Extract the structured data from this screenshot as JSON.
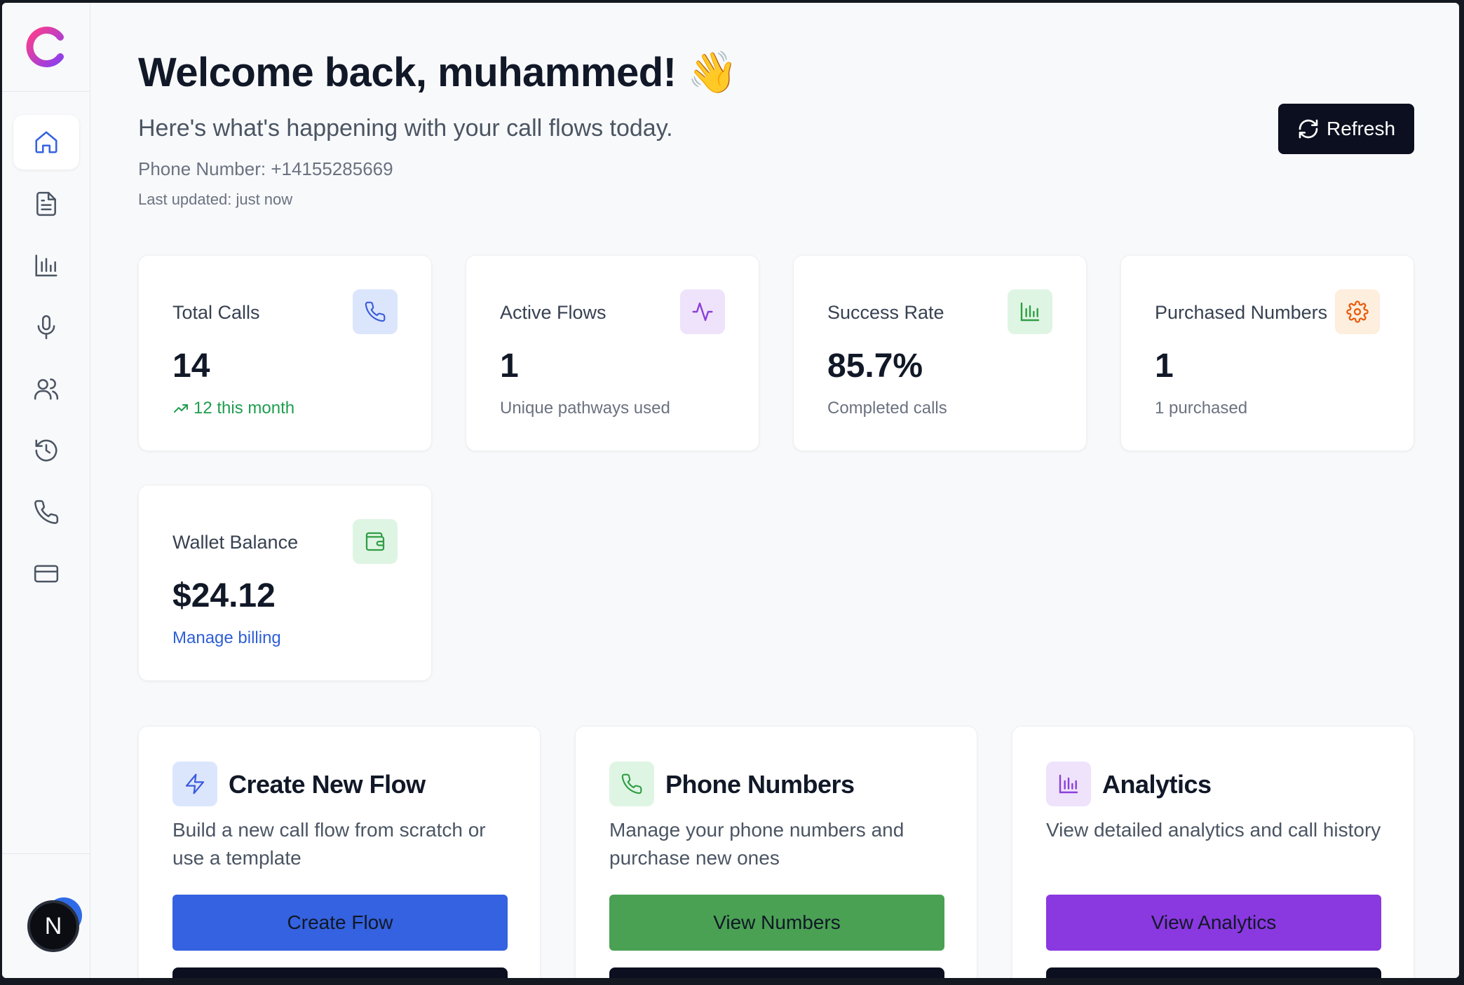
{
  "sidebar": {
    "logo": "brand-logo",
    "items": [
      {
        "icon": "home-icon",
        "active": true
      },
      {
        "icon": "document-icon",
        "active": false
      },
      {
        "icon": "bar-chart-icon",
        "active": false
      },
      {
        "icon": "microphone-icon",
        "active": false
      },
      {
        "icon": "users-icon",
        "active": false
      },
      {
        "icon": "history-icon",
        "active": false
      },
      {
        "icon": "phone-icon",
        "active": false
      },
      {
        "icon": "credit-card-icon",
        "active": false
      }
    ],
    "avatar_initial": "N"
  },
  "header": {
    "welcome": "Welcome back, muhammed! 👋",
    "subtitle": "Here's what's happening with your call flows today.",
    "phone_number": "Phone Number: +14155285669",
    "last_updated": "Last updated: just now",
    "refresh_label": "Refresh"
  },
  "stats": [
    {
      "label": "Total Calls",
      "value": "14",
      "sub": "12 this month",
      "icon": "phone-icon",
      "icon_color": "#3b5bdb",
      "icon_bg": "#dbe6fd"
    },
    {
      "label": "Active Flows",
      "value": "1",
      "sub": "Unique pathways used",
      "icon": "activity-icon",
      "icon_color": "#8b3fd9",
      "icon_bg": "#efe3fb"
    },
    {
      "label": "Success Rate",
      "value": "85.7%",
      "sub": "Completed calls",
      "icon": "bar-chart-icon",
      "icon_color": "#2f9e44",
      "icon_bg": "#dff5e4"
    },
    {
      "label": "Purchased Numbers",
      "value": "1",
      "sub": "1 purchased",
      "icon": "gear-icon",
      "icon_color": "#e8590c",
      "icon_bg": "#fdeedd"
    },
    {
      "label": "Wallet Balance",
      "value": "$24.12",
      "sub": "Manage billing",
      "icon": "wallet-icon",
      "icon_color": "#2f9e44",
      "icon_bg": "#dff5e4"
    }
  ],
  "actions": [
    {
      "title": "Create New Flow",
      "description": "Build a new call flow from scratch or use a template",
      "button": "Create Flow",
      "icon": "lightning-icon",
      "icon_color": "#3b5bdb",
      "icon_bg": "#dbe6fd",
      "button_color": "#3462e0"
    },
    {
      "title": "Phone Numbers",
      "description": "Manage your phone numbers and purchase new ones",
      "button": "View Numbers",
      "icon": "phone-icon",
      "icon_color": "#2f9e44",
      "icon_bg": "#dff5e4",
      "button_color": "#4aa153"
    },
    {
      "title": "Analytics",
      "description": "View detailed analytics and call history",
      "button": "View Analytics",
      "icon": "bar-chart-icon",
      "icon_color": "#8b3fd9",
      "icon_bg": "#efe3fb",
      "button_color": "#8a38e0"
    }
  ]
}
